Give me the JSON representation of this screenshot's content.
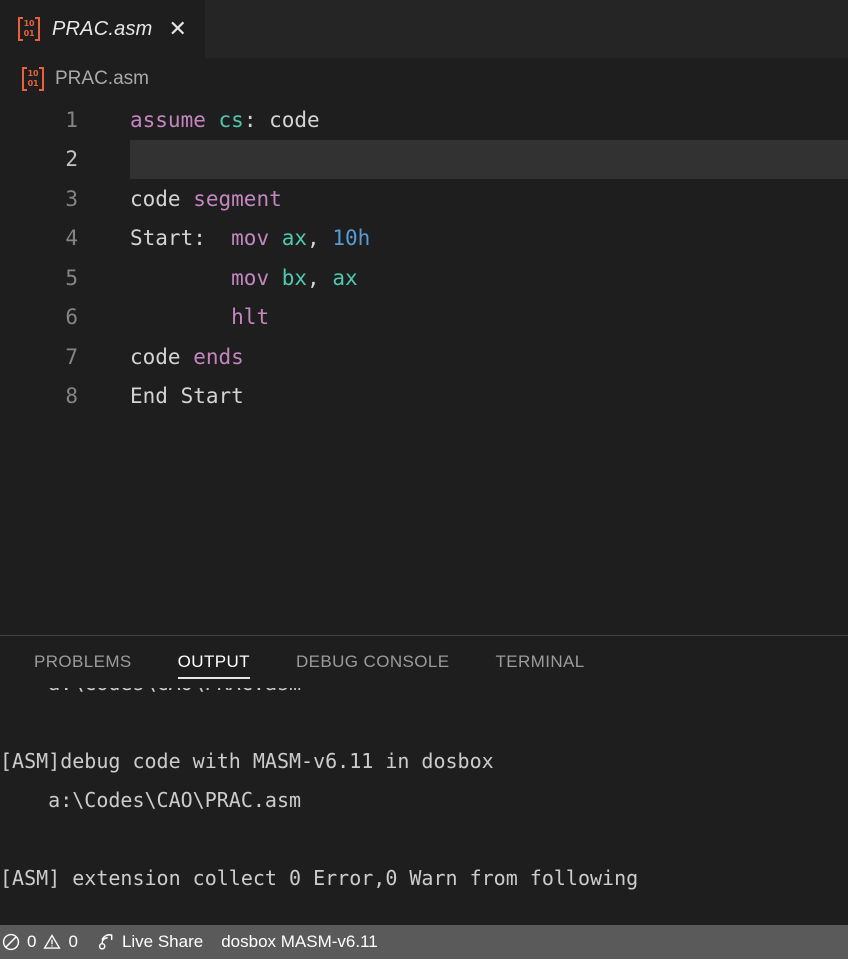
{
  "tab": {
    "icon": "asm-file-icon",
    "icon_digits": [
      "10",
      "01"
    ],
    "label": "PRAC.asm",
    "close_glyph": "✕"
  },
  "breadcrumb": {
    "icon": "asm-file-icon",
    "label": "PRAC.asm"
  },
  "editor": {
    "active_line": 2,
    "lines": [
      {
        "n": "1",
        "tokens": [
          {
            "t": "assume",
            "c": "t-kw"
          },
          {
            "t": " ",
            "c": "t-pl"
          },
          {
            "t": "cs",
            "c": "t-reg"
          },
          {
            "t": ":",
            "c": "t-pl"
          },
          {
            "t": " ",
            "c": "t-pl"
          },
          {
            "t": "code",
            "c": "t-txt"
          }
        ]
      },
      {
        "n": "2",
        "tokens": []
      },
      {
        "n": "3",
        "tokens": [
          {
            "t": "code",
            "c": "t-txt"
          },
          {
            "t": " ",
            "c": "t-pl"
          },
          {
            "t": "segment",
            "c": "t-kw"
          }
        ]
      },
      {
        "n": "4",
        "tokens": [
          {
            "t": "Start:",
            "c": "t-txt"
          },
          {
            "t": "  ",
            "c": "t-pl"
          },
          {
            "t": "mov",
            "c": "t-kw"
          },
          {
            "t": " ",
            "c": "t-pl"
          },
          {
            "t": "ax",
            "c": "t-reg"
          },
          {
            "t": ",",
            "c": "t-pl"
          },
          {
            "t": " ",
            "c": "t-pl"
          },
          {
            "t": "10h",
            "c": "t-num"
          }
        ]
      },
      {
        "n": "5",
        "tokens": [
          {
            "t": "        ",
            "c": "t-pl"
          },
          {
            "t": "mov",
            "c": "t-kw"
          },
          {
            "t": " ",
            "c": "t-pl"
          },
          {
            "t": "bx",
            "c": "t-reg"
          },
          {
            "t": ",",
            "c": "t-pl"
          },
          {
            "t": " ",
            "c": "t-pl"
          },
          {
            "t": "ax",
            "c": "t-reg"
          }
        ]
      },
      {
        "n": "6",
        "tokens": [
          {
            "t": "        ",
            "c": "t-pl"
          },
          {
            "t": "hlt",
            "c": "t-kw"
          }
        ]
      },
      {
        "n": "7",
        "tokens": [
          {
            "t": "code",
            "c": "t-txt"
          },
          {
            "t": " ",
            "c": "t-pl"
          },
          {
            "t": "ends",
            "c": "t-kw"
          }
        ]
      },
      {
        "n": "8",
        "tokens": [
          {
            "t": "End Start",
            "c": "t-txt"
          }
        ]
      }
    ]
  },
  "panel": {
    "tabs": [
      {
        "label": "PROBLEMS",
        "active": false
      },
      {
        "label": "OUTPUT",
        "active": true
      },
      {
        "label": "DEBUG CONSOLE",
        "active": false
      },
      {
        "label": "TERMINAL",
        "active": false
      }
    ],
    "output_lines": [
      "    a:\\Codes\\CAO\\PRAC.asm",
      "",
      "[ASM]debug code with MASM-v6.11 in dosbox",
      "    a:\\Codes\\CAO\\PRAC.asm",
      "",
      "[ASM] extension collect 0 Error,0 Warn from following"
    ]
  },
  "statusbar": {
    "background": "#5a5a5a",
    "errors_icon": "error-circle-icon",
    "errors_count": "0",
    "warnings_icon": "warning-triangle-icon",
    "warnings_count": "0",
    "live_share_icon": "broadcast-icon",
    "live_share_label": "Live Share",
    "build_target_label": "dosbox MASM-v6.11"
  },
  "colors": {
    "editor_bg": "#1e1e1e",
    "tabbar_bg": "#252526",
    "active_line_bg": "#323232",
    "keyword": "#c586c0",
    "register": "#4ec9b0",
    "number": "#569cd6",
    "plain": "#d4d4d4",
    "icon_orange": "#e8613c",
    "statusbar_bg": "#5a5a5a"
  }
}
